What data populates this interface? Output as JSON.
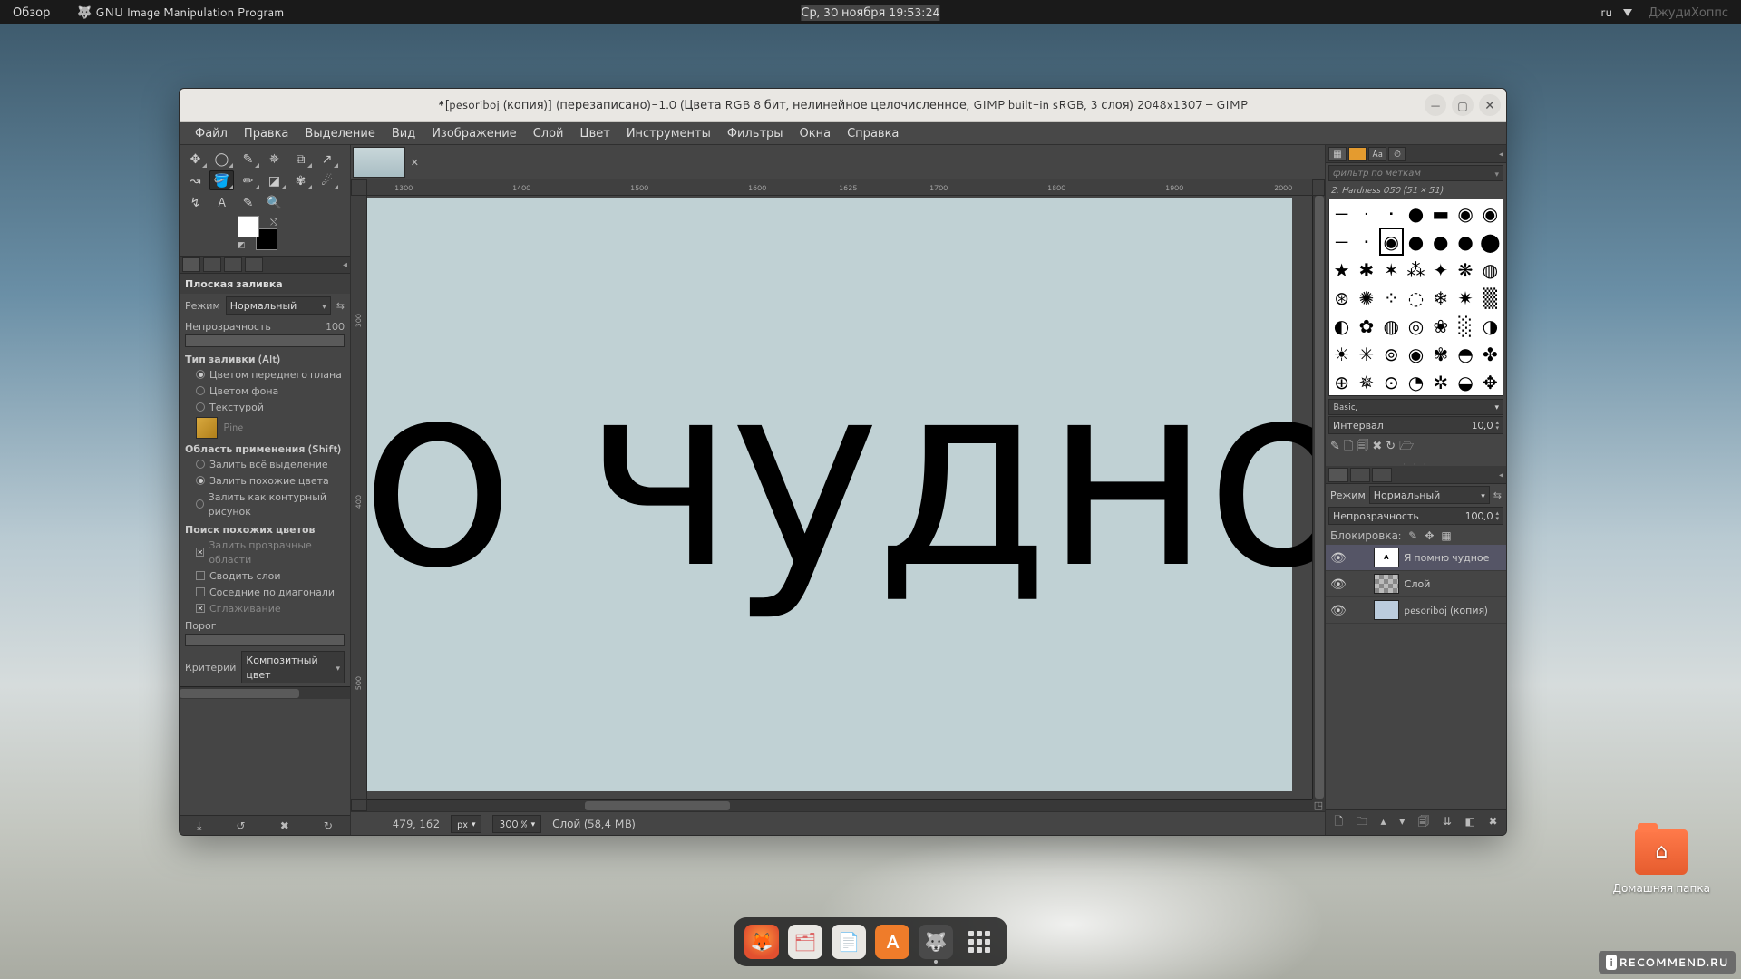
{
  "topbar": {
    "overview": "Обзор",
    "app": "GNU Image Manipulation Program",
    "datetime": "Ср, 30 ноября  19:53:24",
    "lang": "ru",
    "watermark": "ДжудиХоппс"
  },
  "desktop": {
    "home_folder": "Домашняя папка",
    "recommend": "RECOMMEND.RU"
  },
  "window": {
    "title": "*[pesoriboj (копия)] (перезаписано)-1.0 (Цвета RGB 8 бит, нелинейное целочисленное, GIMP built-in sRGB, 3 слоя) 2048x1307 – GIMP"
  },
  "menu": [
    "Файл",
    "Правка",
    "Выделение",
    "Вид",
    "Изображение",
    "Слой",
    "Цвет",
    "Инструменты",
    "Фильтры",
    "Окна",
    "Справка"
  ],
  "toolopts": {
    "name": "Плоская заливка",
    "mode_label": "Режим",
    "mode_value": "Нормальный",
    "opacity_label": "Непрозрачность",
    "opacity_value": "100",
    "fill_type": "Тип заливки (Alt)",
    "fill_fg": "Цветом переднего плана",
    "fill_bg": "Цветом фона",
    "fill_pattern": "Текстурой",
    "pattern_name": "Pine",
    "affect": "Область применения (Shift)",
    "affect_all": "Залить всё выделение",
    "affect_similar": "Залить похожие цвета",
    "affect_lineart": "Залить как контурный рисунок",
    "similar": "Поиск похожих цветов",
    "transparent": "Залить прозрачные области",
    "merged": "Сводить слои",
    "diagonal": "Соседние по диагонали",
    "antialias": "Сглаживание",
    "threshold": "Порог",
    "criterion": "Критерий",
    "criterion_val": "Композитный цвет"
  },
  "ruler_h": [
    "1300",
    "1400",
    "1500",
    "1600",
    "1625",
    "1700",
    "1800",
    "1900",
    "2000"
  ],
  "ruler_v": [
    "300",
    "400",
    "500"
  ],
  "canvas_text": "о чудно",
  "statusbar": {
    "coord": "479, 162",
    "unit": "px",
    "zoom": "300 %",
    "msg": "Слой (58,4 MB)"
  },
  "brushes": {
    "filter_placeholder": "фильтр по меткам",
    "selected_name": "2. Hardness 050 (51 × 51)",
    "pattern_preset": "Basic,",
    "spacing_label": "Интервал",
    "spacing_value": "10,0"
  },
  "layers": {
    "mode_label": "Режим",
    "mode_value": "Нормальный",
    "opacity_label": "Непрозрачность",
    "opacity_value": "100,0",
    "lock_label": "Блокировка:",
    "items": [
      {
        "name": "Я помню чудное"
      },
      {
        "name": "Слой"
      },
      {
        "name": "pesoriboj (копия)"
      }
    ]
  }
}
